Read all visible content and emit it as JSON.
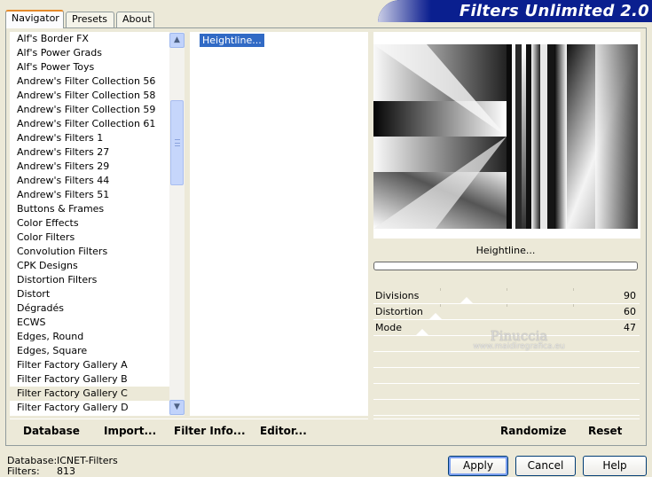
{
  "tabs": [
    {
      "label": "Navigator",
      "active": true
    },
    {
      "label": "Presets",
      "active": false
    },
    {
      "label": "About",
      "active": false
    }
  ],
  "banner": {
    "title": "Filters Unlimited 2.0"
  },
  "filter_list": {
    "items": [
      "Alf's Border FX",
      "Alf's Power Grads",
      "Alf's Power Toys",
      "Andrew's Filter Collection 56",
      "Andrew's Filter Collection 58",
      "Andrew's Filter Collection 59",
      "Andrew's Filter Collection 61",
      "Andrew's Filters 1",
      "Andrew's Filters 27",
      "Andrew's Filters 29",
      "Andrew's Filters 44",
      "Andrew's Filters 51",
      "Buttons & Frames",
      "Color Effects",
      "Color Filters",
      "Convolution Filters",
      "CPK Designs",
      "Distortion Filters",
      "Distort",
      "Dégradés",
      "ECWS",
      "Edges, Round",
      "Edges, Square",
      "Filter Factory Gallery A",
      "Filter Factory Gallery B",
      "Filter Factory Gallery C",
      "Filter Factory Gallery D"
    ],
    "selected": "Filter Factory Gallery C"
  },
  "sub_list": {
    "items": [
      "Heightline..."
    ],
    "selected": "Heightline..."
  },
  "preview": {
    "filter_name": "Heightline..."
  },
  "params": [
    {
      "label": "Divisions",
      "value": "90"
    },
    {
      "label": "Distortion",
      "value": "60"
    },
    {
      "label": "Mode",
      "value": "47"
    }
  ],
  "watermark": {
    "title": "Pinuccia",
    "url": "www.maidiregrafica.eu"
  },
  "actions": {
    "database": "Database",
    "import": "Import...",
    "filter_info": "Filter Info...",
    "editor": "Editor...",
    "randomize": "Randomize",
    "reset": "Reset"
  },
  "footer": {
    "database_label": "Database:",
    "database_value": "ICNET-Filters",
    "filters_label": "Filters:",
    "filters_value": "813"
  },
  "buttons": {
    "apply": "Apply",
    "cancel": "Cancel",
    "help": "Help"
  }
}
